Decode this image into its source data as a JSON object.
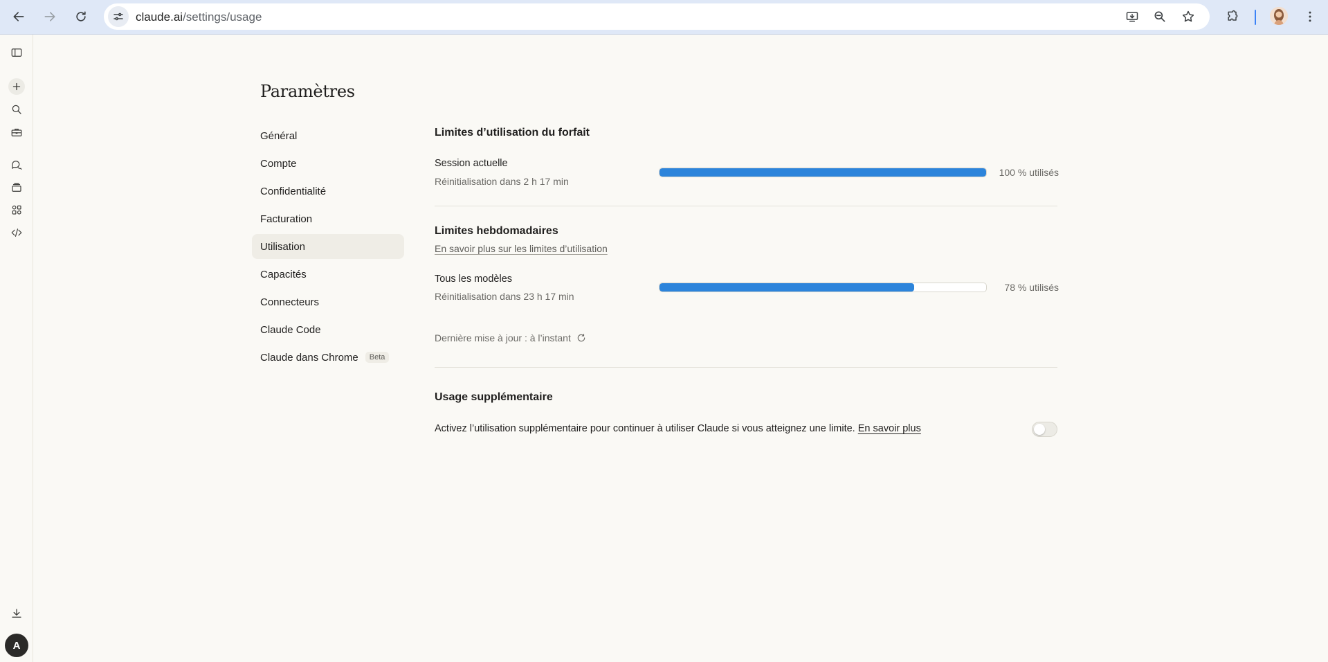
{
  "browser": {
    "url_host": "claude.ai",
    "url_path": "/settings/usage"
  },
  "settings": {
    "title": "Paramètres",
    "nav": [
      {
        "label": "Général",
        "active": false
      },
      {
        "label": "Compte",
        "active": false
      },
      {
        "label": "Confidentialité",
        "active": false
      },
      {
        "label": "Facturation",
        "active": false
      },
      {
        "label": "Utilisation",
        "active": true
      },
      {
        "label": "Capacités",
        "active": false
      },
      {
        "label": "Connecteurs",
        "active": false
      },
      {
        "label": "Claude Code",
        "active": false
      },
      {
        "label": "Claude dans Chrome",
        "active": false,
        "badge": "Beta"
      }
    ]
  },
  "usage": {
    "plan_title": "Limites d’utilisation du forfait",
    "session": {
      "label": "Session actuelle",
      "reset": "Réinitialisation dans 2 h 17 min",
      "percent": 100,
      "percent_label": "100 % utilisés"
    },
    "weekly_title": "Limites hebdomadaires",
    "weekly_link": "En savoir plus sur les limites d’utilisation",
    "all_models": {
      "label": "Tous les modèles",
      "reset": "Réinitialisation dans 23 h 17 min",
      "percent": 78,
      "percent_label": "78 % utilisés"
    },
    "last_updated": "Dernière mise à jour : à l’instant",
    "extra_title": "Usage supplémentaire",
    "extra_desc": "Activez l’utilisation supplémentaire pour continuer à utiliser Claude si vous atteignez une limite.",
    "extra_link": "En savoir plus",
    "extra_enabled": false
  },
  "rail": {
    "avatar_initial": "A"
  },
  "colors": {
    "accent_bar": "#2c84db",
    "background": "#faf9f5"
  }
}
